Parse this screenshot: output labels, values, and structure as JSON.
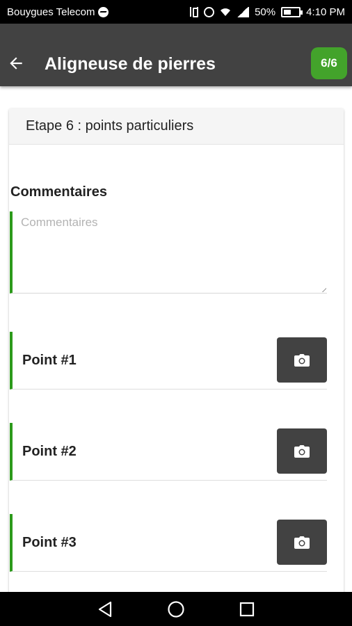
{
  "status_bar": {
    "carrier": "Bouygues Telecom",
    "battery": "50%",
    "time": "4:10 PM"
  },
  "app_bar": {
    "title": "Aligneuse de pierres",
    "step_badge": "6/6"
  },
  "card": {
    "title": "Etape 6 : points particuliers",
    "comment_label": "Commentaires",
    "comment_placeholder": "Commentaires",
    "comment_value": ""
  },
  "points": [
    {
      "label": "Point #1"
    },
    {
      "label": "Point #2"
    },
    {
      "label": "Point #3"
    }
  ],
  "colors": {
    "app_bar": "#424242",
    "accent_green": "#43a32b",
    "border_green": "#2c9a1b",
    "camera_button": "#424242"
  },
  "icons": [
    "back-arrow-icon",
    "camera-icon",
    "nav-back-icon",
    "nav-home-icon",
    "nav-recents-icon"
  ]
}
